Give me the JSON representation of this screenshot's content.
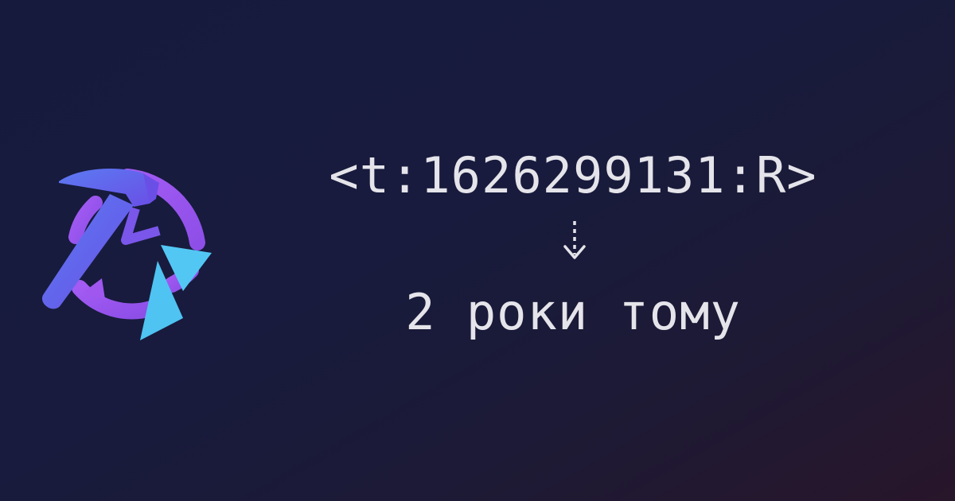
{
  "logo": {
    "icon": "hammer-clock-logo-icon",
    "colors": {
      "hammer_light": "#5b7bf2",
      "hammer_dark": "#6a4fe6",
      "arc": "#9f57ef",
      "arrow": "#53c7f4"
    }
  },
  "timestamp": {
    "code": "<t:1626299131:R>",
    "arrow_icon": "dashed-down-arrow-icon",
    "result": "2 роки тому"
  },
  "colors": {
    "background_start": "#161b3d",
    "background_end": "#28162a",
    "text": "#e4e4ea"
  }
}
